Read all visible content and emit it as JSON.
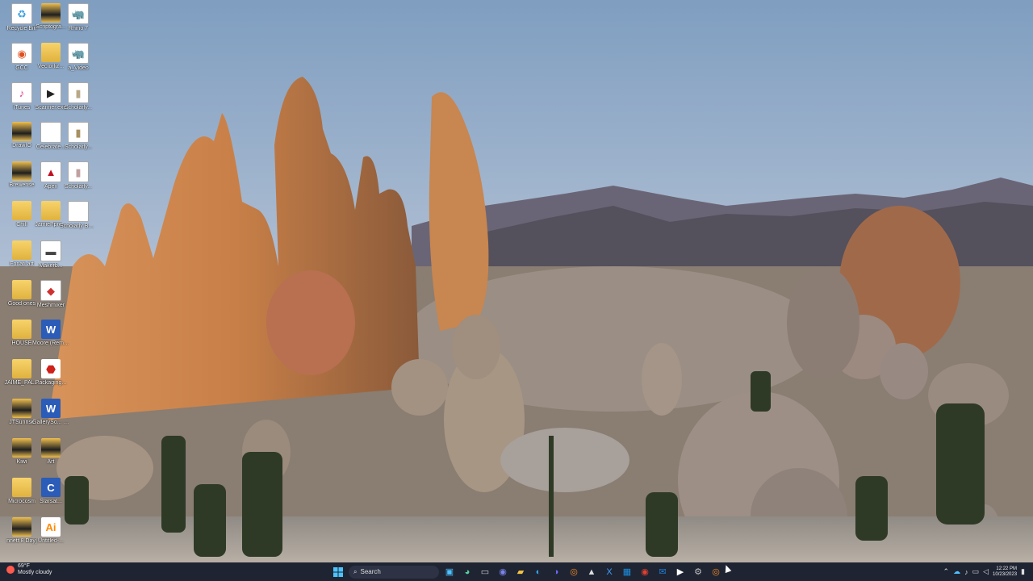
{
  "desktop": {
    "icons": [
      {
        "label": "Recycle Bin",
        "icon": "recycle-bin-icon",
        "glyph": "♻",
        "style": "doc",
        "color": "#3aa0e0"
      },
      {
        "label": "Scriptogra...",
        "icon": "folder-icon",
        "glyph": "",
        "style": "folder-dark",
        "color": ""
      },
      {
        "label": "Rhino 7",
        "icon": "rhino-icon",
        "glyph": "🦏",
        "style": "doc",
        "color": "#222"
      },
      {
        "label": "GCC",
        "icon": "gcc-icon",
        "glyph": "◉",
        "style": "doc",
        "color": "#e05020"
      },
      {
        "label": "Vectorliz...",
        "icon": "folder-icon",
        "glyph": "",
        "style": "folder",
        "color": ""
      },
      {
        "label": "a_Video",
        "icon": "rhino-icon",
        "glyph": "🦏",
        "style": "doc",
        "color": "#222"
      },
      {
        "label": "iTunes",
        "icon": "itunes-icon",
        "glyph": "♪",
        "style": "doc",
        "color": "#e0408a"
      },
      {
        "label": "Scanner.exe",
        "icon": "app-icon",
        "glyph": "▶",
        "style": "doc",
        "color": "#222"
      },
      {
        "label": "Scholarly...",
        "icon": "image-icon",
        "glyph": "▮",
        "style": "doc",
        "color": "#b8a888"
      },
      {
        "label": "DrawIO",
        "icon": "folder-icon",
        "glyph": "",
        "style": "folder-dark",
        "color": ""
      },
      {
        "label": "Celebrate...",
        "icon": "document-icon",
        "glyph": "",
        "style": "doc",
        "color": ""
      },
      {
        "label": "Scholarly...",
        "icon": "image-icon",
        "glyph": "▮",
        "style": "doc",
        "color": "#a89060"
      },
      {
        "label": "Brewerise",
        "icon": "folder-icon",
        "glyph": "",
        "style": "folder-dark",
        "color": ""
      },
      {
        "label": "Apex",
        "icon": "apex-icon",
        "glyph": "▲",
        "style": "doc",
        "color": "#c01020"
      },
      {
        "label": "Scholarly...",
        "icon": "image-icon",
        "glyph": "▮",
        "style": "doc",
        "color": "#c0a0a0"
      },
      {
        "label": "Chill",
        "icon": "folder-icon",
        "glyph": "",
        "style": "folder",
        "color": ""
      },
      {
        "label": "JamiePpre...",
        "icon": "folder-icon",
        "glyph": "",
        "style": "folder",
        "color": ""
      },
      {
        "label": "Scholarly Background...",
        "icon": "document-icon",
        "glyph": "",
        "style": "doc",
        "color": ""
      },
      {
        "label": "Fonati art",
        "icon": "folder-icon",
        "glyph": "",
        "style": "folder",
        "color": ""
      },
      {
        "label": "Makerb...",
        "icon": "app-icon",
        "glyph": "▬",
        "style": "doc",
        "color": "#444"
      },
      {
        "label": "",
        "icon": "",
        "glyph": "",
        "style": "",
        "color": ""
      },
      {
        "label": "Good ones",
        "icon": "folder-icon",
        "glyph": "",
        "style": "folder",
        "color": ""
      },
      {
        "label": "Meshmixer",
        "icon": "meshmixer-icon",
        "glyph": "◆",
        "style": "doc",
        "color": "#d03030"
      },
      {
        "label": "",
        "icon": "",
        "glyph": "",
        "style": "",
        "color": ""
      },
      {
        "label": "HOUSE",
        "icon": "folder-icon",
        "glyph": "",
        "style": "folder",
        "color": ""
      },
      {
        "label": "Moore (Remodel)...",
        "icon": "word-doc-icon",
        "glyph": "W",
        "style": "word",
        "color": ""
      },
      {
        "label": "",
        "icon": "",
        "glyph": "",
        "style": "",
        "color": ""
      },
      {
        "label": "JAIME_PAL...",
        "icon": "folder-icon",
        "glyph": "",
        "style": "folder",
        "color": ""
      },
      {
        "label": "Packaging...",
        "icon": "pdf-icon",
        "glyph": "⬣",
        "style": "pdf",
        "color": ""
      },
      {
        "label": "",
        "icon": "",
        "glyph": "",
        "style": "",
        "color": ""
      },
      {
        "label": "JTSunrise",
        "icon": "folder-icon",
        "glyph": "",
        "style": "folder-dark",
        "color": ""
      },
      {
        "label": "GallerySo... Huntley.d...",
        "icon": "word-doc-icon",
        "glyph": "W",
        "style": "word",
        "color": ""
      },
      {
        "label": "",
        "icon": "",
        "glyph": "",
        "style": "",
        "color": ""
      },
      {
        "label": "Kiwi",
        "icon": "folder-icon",
        "glyph": "",
        "style": "folder-dark",
        "color": ""
      },
      {
        "label": "Art",
        "icon": "folder-icon",
        "glyph": "",
        "style": "folder-dark",
        "color": ""
      },
      {
        "label": "",
        "icon": "",
        "glyph": "",
        "style": "",
        "color": ""
      },
      {
        "label": "Microcosm",
        "icon": "folder-icon",
        "glyph": "",
        "style": "folder",
        "color": ""
      },
      {
        "label": "Starsat...",
        "icon": "app-icon",
        "glyph": "C",
        "style": "word",
        "color": ""
      },
      {
        "label": "",
        "icon": "",
        "glyph": "",
        "style": "",
        "color": ""
      },
      {
        "label": "nnett 8 Day]",
        "icon": "folder-icon",
        "glyph": "",
        "style": "folder-dark",
        "color": ""
      },
      {
        "label": "Untitled-...",
        "icon": "illustrator-icon",
        "glyph": "Ai",
        "style": "pdf",
        "color": "#ff8a00"
      }
    ]
  },
  "taskbar": {
    "weather_temp": "69°F",
    "weather_desc": "Mostly cloudy",
    "search_label": "Search",
    "clock_time": "12:22 PM",
    "clock_date": "10/23/2023",
    "apps": [
      {
        "name": "files-icon",
        "glyph": "▣",
        "color": "#4cc2ff"
      },
      {
        "name": "copilot-icon",
        "glyph": "◕",
        "color": "#55d0a0"
      },
      {
        "name": "task-view-icon",
        "glyph": "▭",
        "color": "#cfcfcf"
      },
      {
        "name": "chat-icon",
        "glyph": "◉",
        "color": "#7b83eb"
      },
      {
        "name": "file-explorer-icon",
        "glyph": "▰",
        "color": "#f4c542"
      },
      {
        "name": "edge-icon",
        "glyph": "◐",
        "color": "#2fa5e5"
      },
      {
        "name": "app-icon",
        "glyph": "◑",
        "color": "#6b6bff"
      },
      {
        "name": "blender-icon",
        "glyph": "◎",
        "color": "#f08a24"
      },
      {
        "name": "rhino-icon",
        "glyph": "▲",
        "color": "#dddddd"
      },
      {
        "name": "vscode-icon",
        "glyph": "X",
        "color": "#3aa0ff"
      },
      {
        "name": "calculator-icon",
        "glyph": "▦",
        "color": "#1a8fe0"
      },
      {
        "name": "chrome-icon",
        "glyph": "◉",
        "color": "#e04030"
      },
      {
        "name": "outlook-icon",
        "glyph": "✉",
        "color": "#1c7fd8"
      },
      {
        "name": "media-player-icon",
        "glyph": "▶",
        "color": "#ffffff"
      },
      {
        "name": "settings-icon",
        "glyph": "⚙",
        "color": "#c0c0c0"
      },
      {
        "name": "blender-icon",
        "glyph": "◎",
        "color": "#f08a24"
      }
    ]
  }
}
